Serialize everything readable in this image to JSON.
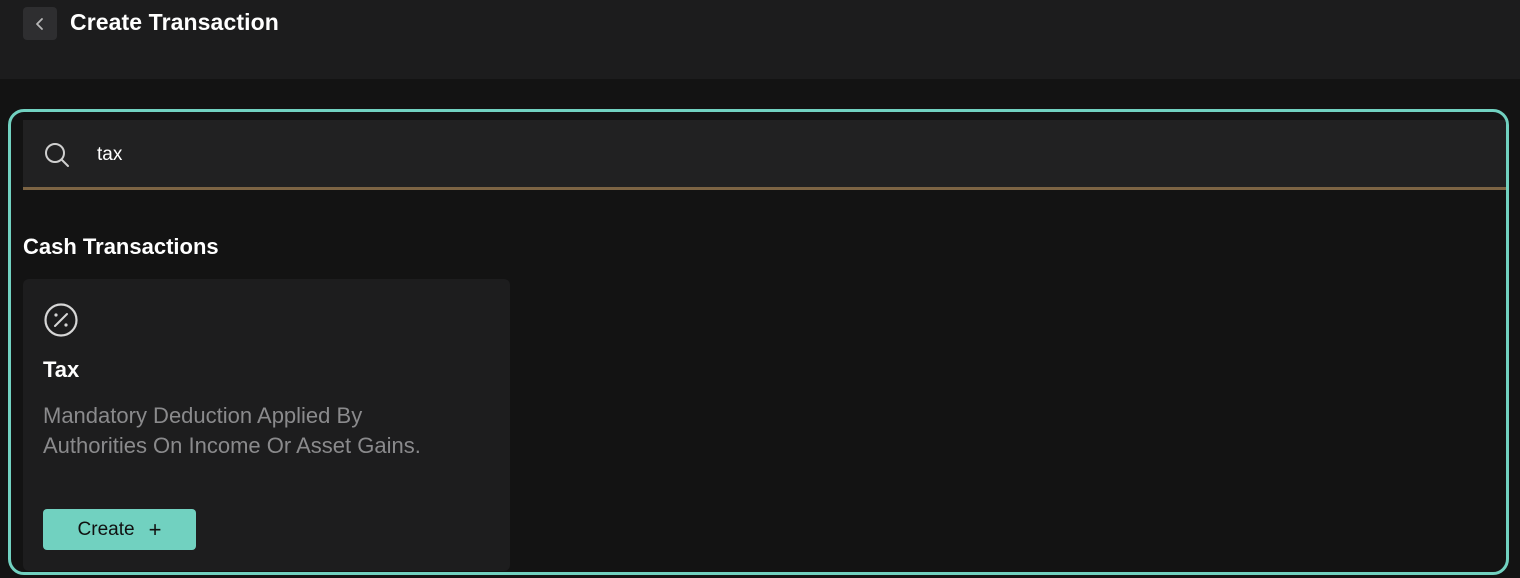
{
  "header": {
    "title": "Create Transaction",
    "back_icon": "chevron-left-icon"
  },
  "search": {
    "value": "tax",
    "icon": "search-icon"
  },
  "section": {
    "title": "Cash Transactions"
  },
  "card": {
    "icon": "percent-circle-icon",
    "title": "Tax",
    "description": "Mandatory Deduction Applied By Authorities On Income Or Asset Gains.",
    "button_label": "Create",
    "button_icon": "+"
  },
  "colors": {
    "accent": "#71d1c0",
    "search_underline": "#7c6444",
    "background": "#131313",
    "header_bg": "#1c1c1d",
    "card_bg": "#1d1d1e",
    "muted_text": "#8a8a8c"
  }
}
